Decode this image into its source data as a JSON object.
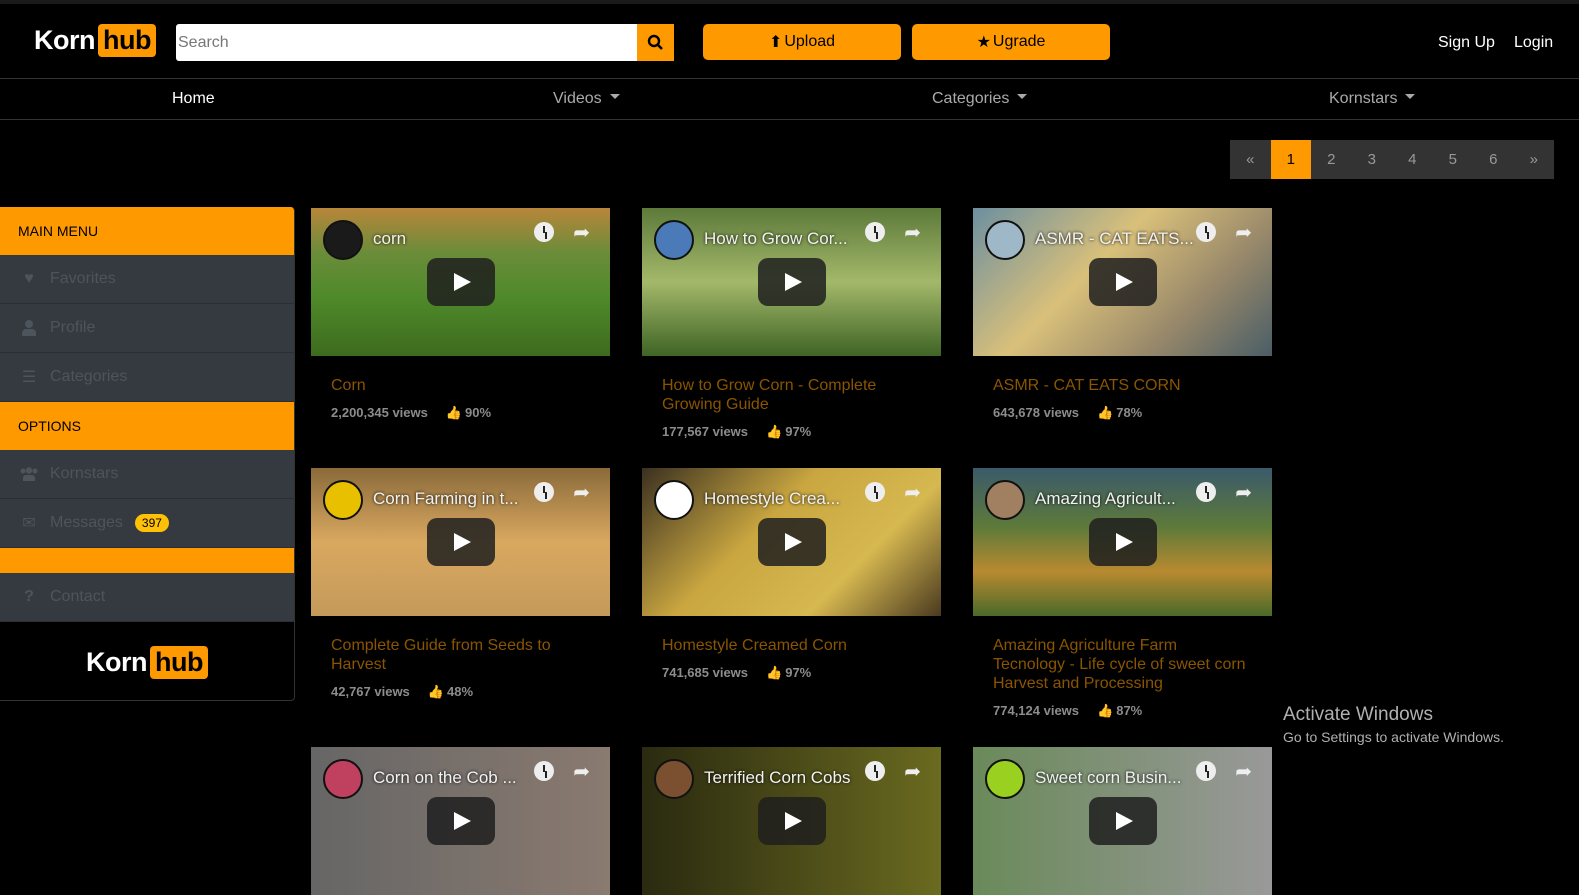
{
  "header": {
    "logo": {
      "left": "Korn",
      "right": "hub"
    },
    "search_placeholder": "Search",
    "upload_label": "Upload",
    "upgrade_label": "Ugrade",
    "signup_label": "Sign Up",
    "login_label": "Login"
  },
  "nav": [
    {
      "label": "Home",
      "active": true
    },
    {
      "label": "Videos",
      "dropdown": true
    },
    {
      "label": "Categories",
      "dropdown": true
    },
    {
      "label": "Kornstars",
      "dropdown": true
    }
  ],
  "pagination": {
    "prev": "«",
    "pages": [
      "1",
      "2",
      "3",
      "4",
      "5",
      "6"
    ],
    "current": "1",
    "next": "»"
  },
  "sidebar": {
    "main_menu": "MAIN MENU",
    "main_items": [
      {
        "label": "Favorites",
        "icon": "heart-icon"
      },
      {
        "label": "Profile",
        "icon": "user-icon"
      },
      {
        "label": "Categories",
        "icon": "list-check-icon"
      }
    ],
    "options": "OPTIONS",
    "option_items": [
      {
        "label": "Kornstars",
        "icon": "users-icon"
      },
      {
        "label": "Messages",
        "icon": "envelope-icon",
        "badge": "397"
      }
    ],
    "contact": {
      "label": "Contact",
      "icon": "question-icon"
    },
    "logo": {
      "left": "Korn",
      "right": "hub"
    }
  },
  "colors": {
    "accent": "#ff9900",
    "title": "#8a5500",
    "like": "#3a7d12"
  },
  "videos": [
    {
      "overlay": "corn",
      "title": "Corn",
      "views": "2,200,345 views",
      "rating": "90%"
    },
    {
      "overlay": "How to Grow Cor...",
      "title": "How to Grow Corn - Complete Growing Guide",
      "views": "177,567 views",
      "rating": "97%"
    },
    {
      "overlay": "ASMR - CAT EATS...",
      "title": "ASMR - CAT EATS CORN",
      "views": "643,678 views",
      "rating": "78%"
    },
    {
      "overlay": "Corn Farming in t...",
      "title": "Complete Guide from Seeds to Harvest",
      "views": "42,767 views",
      "rating": "48%"
    },
    {
      "overlay": "Homestyle Crea...",
      "title": "Homestyle Creamed Corn",
      "views": "741,685 views",
      "rating": "97%"
    },
    {
      "overlay": "Amazing Agricult...",
      "title": "Amazing Agriculture Farm Tecnology - Life cycle of sweet corn Harvest and Processing",
      "views": "774,124 views",
      "rating": "87%"
    },
    {
      "overlay": "Corn on the Cob ..."
    },
    {
      "overlay": "Terrified Corn Cobs"
    },
    {
      "overlay": "Sweet corn Busin..."
    }
  ],
  "watermark": {
    "title": "Activate Windows",
    "subtitle": "Go to Settings to activate Windows."
  }
}
